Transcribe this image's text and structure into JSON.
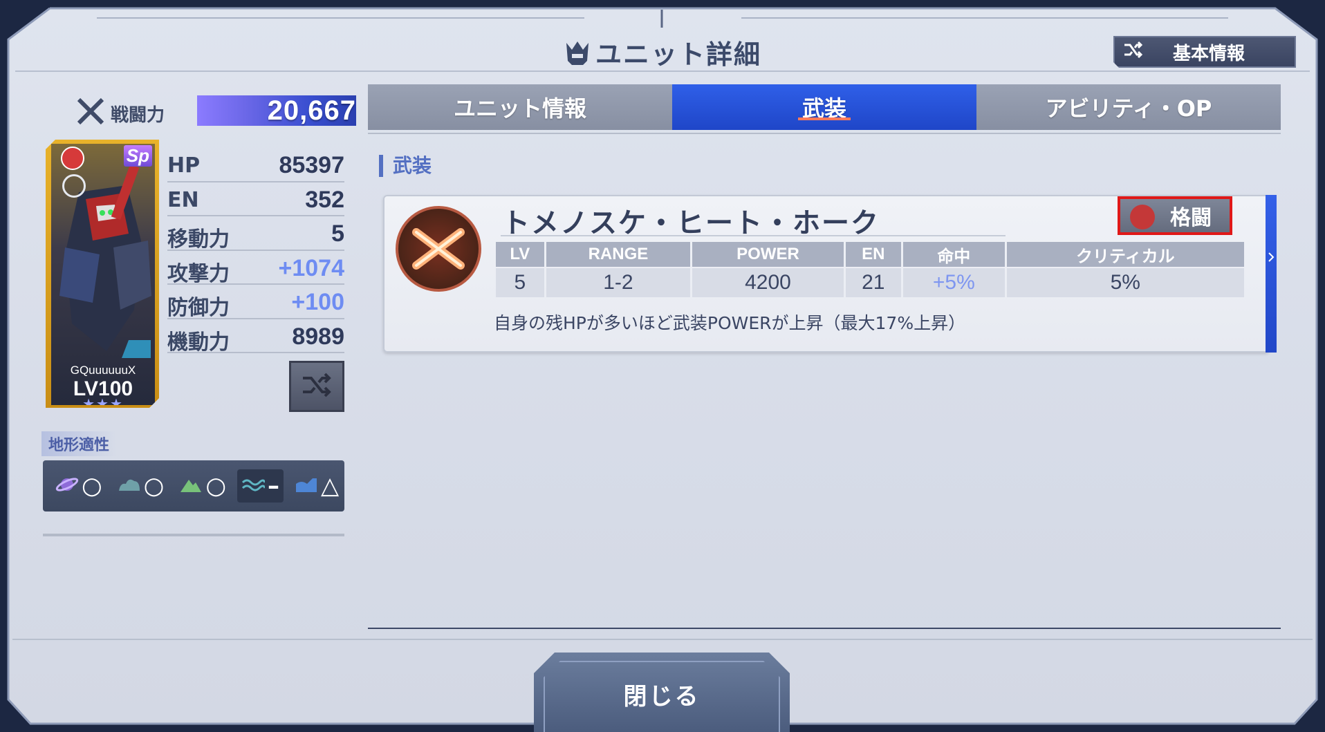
{
  "header": {
    "title": "ユニット詳細",
    "basic_info_label": "基本情報"
  },
  "left": {
    "power_label": "戦闘力",
    "power_value": "20,667",
    "unit_card": {
      "name": "GQuuuuuuX",
      "level": "LV100",
      "stars": "★★★",
      "sp_label": "Sp"
    },
    "stats": [
      {
        "label": "HP",
        "value": "85397",
        "bonus": false
      },
      {
        "label": "EN",
        "value": "352",
        "bonus": false
      },
      {
        "label": "移動力",
        "value": "5",
        "bonus": false
      },
      {
        "label": "攻撃力",
        "value": "+1074",
        "bonus": true
      },
      {
        "label": "防御力",
        "value": "+100",
        "bonus": true
      },
      {
        "label": "機動力",
        "value": "8989",
        "bonus": false
      }
    ],
    "terrain_label": "地形適性",
    "terrain": [
      {
        "icon": "space-icon",
        "mark": "○"
      },
      {
        "icon": "air-icon",
        "mark": "○"
      },
      {
        "icon": "ground-icon",
        "mark": "○"
      },
      {
        "icon": "water-icon",
        "mark": "–"
      },
      {
        "icon": "underwater-icon",
        "mark": "△"
      }
    ]
  },
  "tabs": [
    {
      "label": "ユニット情報",
      "active": false
    },
    {
      "label": "武装",
      "active": true
    },
    {
      "label": "アビリティ・OP",
      "active": false
    }
  ],
  "section_label": "武装",
  "weapon": {
    "name": "トメノスケ・ヒート・ホーク",
    "type_label": "格闘",
    "headers": [
      "LV",
      "RANGE",
      "POWER",
      "EN",
      "命中",
      "クリティカル"
    ],
    "values": [
      "5",
      "1-2",
      "4200",
      "21",
      "+5%",
      "5%"
    ],
    "description": "自身の残HPが多いほど武装POWERが上昇（最大17%上昇）"
  },
  "footer": {
    "close_label": "閉じる"
  },
  "colors": {
    "accent_blue": "#2f5fe8",
    "highlight_red": "#e01818",
    "bonus_blue": "#6e8cf2"
  }
}
